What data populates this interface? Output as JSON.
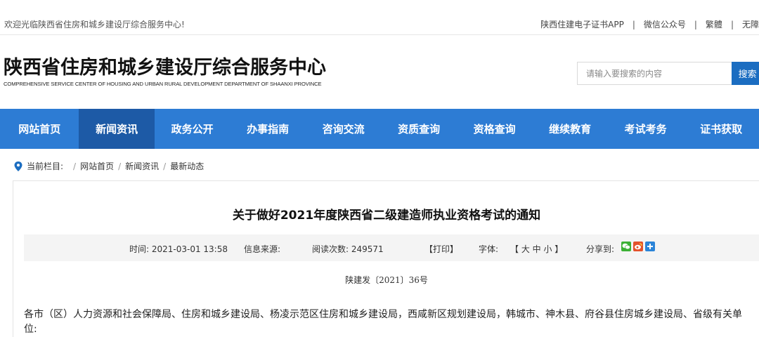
{
  "topbar": {
    "welcome": "欢迎光临陕西省住房和城乡建设厅综合服务中心!",
    "links": [
      "陕西住建电子证书APP",
      "微信公众号",
      "繁體",
      "无障"
    ],
    "separator": "|"
  },
  "header": {
    "title_cn": "陕西省住房和城乡建设厅综合服务中心",
    "title_en": "COMPREHENSIVE SERVICE CENTER OF HOUSING AND URBAN RURAL DEVELOPMENT DEPARTMENT OF SHAANXI PROVINCE",
    "search_placeholder": "请输入要搜索的内容",
    "search_button": "搜索"
  },
  "nav": {
    "items": [
      "网站首页",
      "新闻资讯",
      "政务公开",
      "办事指南",
      "咨询交流",
      "资质查询",
      "资格查询",
      "继续教育",
      "考试考务",
      "证书获取"
    ],
    "active_index": 1,
    "active_color": "#1d5aa6",
    "bar_color": "#2d7cd4"
  },
  "breadcrumb": {
    "label": "当前栏目:",
    "items": [
      "网站首页",
      "新闻资讯",
      "最新动态"
    ],
    "separator": "/"
  },
  "article": {
    "title": "关于做好2021年度陕西省二级建造师执业资格考试的通知",
    "meta": {
      "time": "时间: 2021-03-01 13:58",
      "source": "信息来源:",
      "reads": "阅读次数:  249571",
      "print": "【打印】",
      "font_label": "字体:",
      "font_sizes": "【 大  中  小 】",
      "share_label": "分享到:"
    },
    "share_icons": [
      "wechat-icon",
      "weibo-icon",
      "more-share-icon"
    ],
    "doc_no": "陕建发〔2021〕36号",
    "body": "各市（区）人力资源和社会保障局、住房和城乡建设局、杨凌示范区住房和城乡建设局，西咸新区规划建设局，韩城市、神木县、府谷县住房城乡建设局、省级有关单位:"
  }
}
